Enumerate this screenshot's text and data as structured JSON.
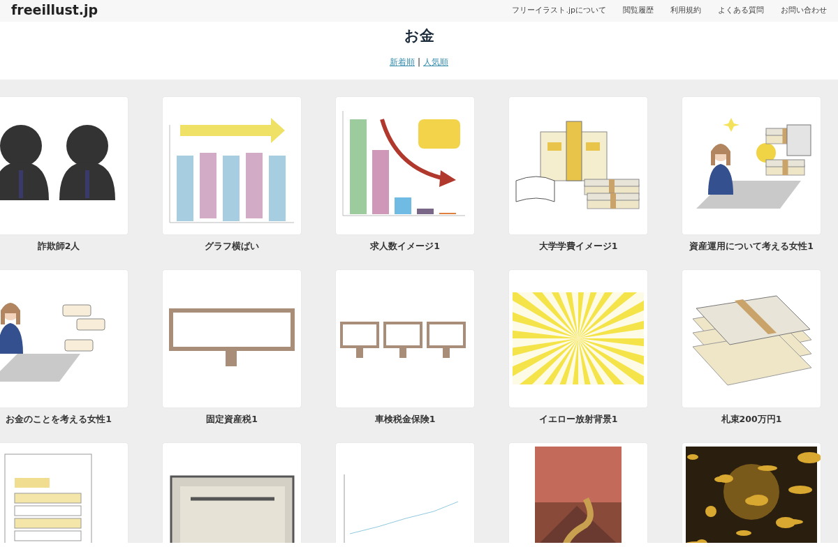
{
  "header": {
    "logo": "freeillust.jp",
    "nav": [
      "フリーイラスト.jpについて",
      "閲覧履歴",
      "利用規約",
      "よくある質問",
      "お問い合わせ"
    ]
  },
  "page_title": "お金",
  "sort": {
    "links": [
      {
        "label": "新着順"
      },
      {
        "label": "人気順"
      }
    ],
    "separator": "|"
  },
  "items": [
    {
      "kind": "picture",
      "caption": "詐欺師2人"
    },
    {
      "kind": "picture",
      "caption": "グラフ横ばい"
    },
    {
      "kind": "picture",
      "caption": "求人数イメージ1"
    },
    {
      "kind": "picture",
      "caption": "大学学費イメージ1"
    },
    {
      "kind": "picture",
      "caption": "資産運用について考える女性1"
    },
    {
      "kind": "picture",
      "caption": "お金のことを考える女性1"
    },
    {
      "kind": "picture",
      "caption": "固定資産税1"
    },
    {
      "kind": "picture",
      "caption": "車検税金保険1"
    },
    {
      "kind": "picture",
      "caption": "イエロー放射背景1"
    },
    {
      "kind": "picture",
      "caption": "札束200万円1"
    },
    {
      "kind": "picture"
    },
    {
      "kind": "picture"
    },
    {
      "kind": "picture"
    },
    {
      "kind": "picture"
    },
    {
      "kind": "picture"
    }
  ]
}
